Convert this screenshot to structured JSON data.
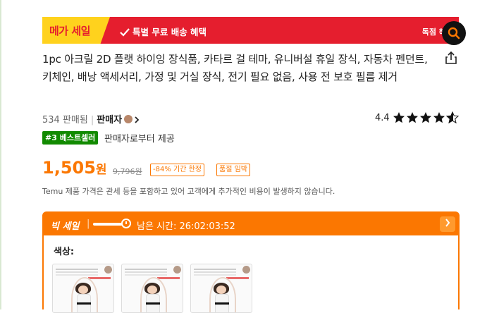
{
  "banner": {
    "mega_sale": "메가 세일",
    "free_shipping": "특별 무료 배송 혜택",
    "exclusive": "독점 혜"
  },
  "product": {
    "title": "1pc 아크릴 2D 플랫 하이잉 장식품, 카타르 걸 테마, 유니버설 휴일 장식, 자동차 펜던트, 키체인, 배낭 액세서리, 가정 및 거실 장식, 전기 필요 없음, 사용 전 보호 필름 제거",
    "sold": "534 판매됨",
    "seller_label": "판매자",
    "rating_value": "4.4",
    "rating": 4.4,
    "bestseller": "#3 베스트셀러",
    "provided_by": "판매자로부터 제공"
  },
  "pricing": {
    "price": "1,505",
    "currency": "원",
    "original": "9,796원",
    "discount": "-84% 기간 한정",
    "low_stock": "품절 임박",
    "notice": "Temu 제품 가격은 관세 등을 포함하고 있어 고객에게 추가적인 비용이 발생하지 않습니다."
  },
  "deal": {
    "title": "빅 세일",
    "separator": "|",
    "countdown": "남은 시간: 26:02:03:52",
    "color_label": "색상:"
  },
  "icons": {
    "search": "search-icon",
    "share": "share-icon",
    "check": "check-icon",
    "chevron": "chevron-right-icon"
  },
  "colors": {
    "accent": "#fb7701",
    "banner_red": "#e51e2e",
    "banner_yellow": "#ffd21d",
    "bestseller_green": "#118a00"
  }
}
